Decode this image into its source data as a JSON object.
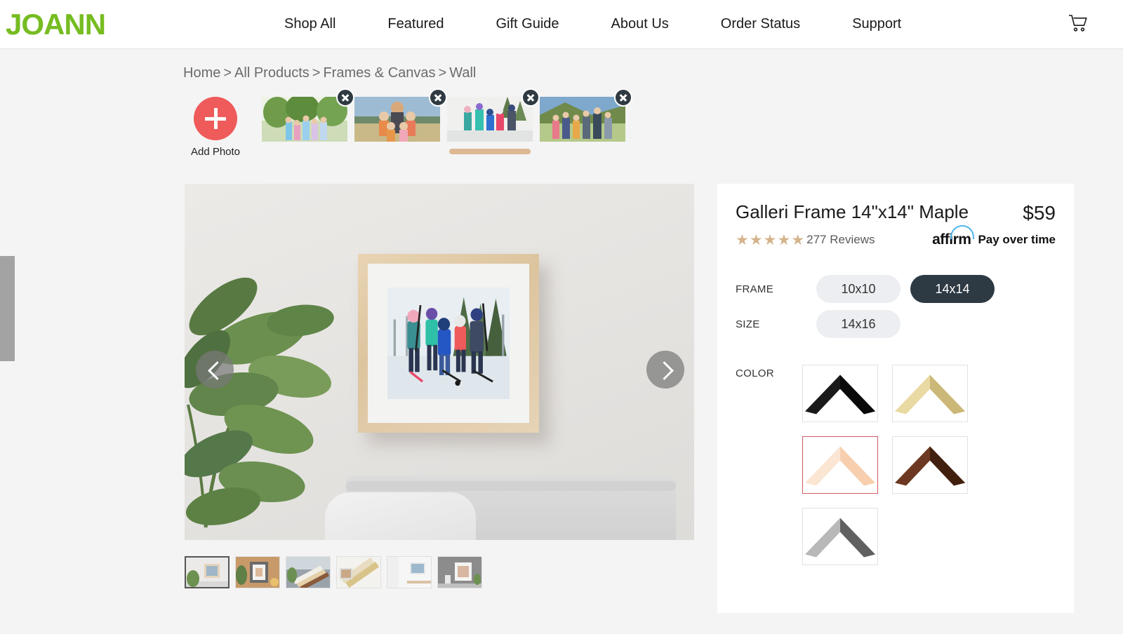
{
  "header": {
    "logo": "JOANN",
    "nav": [
      {
        "label": "Shop All"
      },
      {
        "label": "Featured"
      },
      {
        "label": "Gift Guide"
      },
      {
        "label": "About Us"
      },
      {
        "label": "Order Status"
      },
      {
        "label": "Support"
      }
    ],
    "cart_icon": "shopping-cart-icon"
  },
  "breadcrumb": {
    "items": [
      "Home",
      "All Products",
      "Frames & Canvas",
      "Wall"
    ],
    "separator": ">"
  },
  "photo_strip": {
    "add_photo_label": "Add Photo",
    "add_icon": "plus-icon",
    "delete_icon": "close-circle-icon",
    "photos": [
      {
        "alt": "family-group-trees",
        "selected": false
      },
      {
        "alt": "family-group-beach",
        "selected": false
      },
      {
        "alt": "kids-hockey-winter",
        "selected": true
      },
      {
        "alt": "family-group-vineyard",
        "selected": false
      }
    ]
  },
  "stage": {
    "prev_icon": "chevron-left-icon",
    "next_icon": "chevron-right-icon",
    "scene_alt": "maple-framed-photo-on-living-room-wall"
  },
  "gallery_thumbs": [
    {
      "alt": "framed-photo-livingroom",
      "selected": true
    },
    {
      "alt": "framed-photo-warm-room",
      "selected": false
    },
    {
      "alt": "frame-corners-stack",
      "selected": false
    },
    {
      "alt": "frame-corners-gold",
      "selected": false
    },
    {
      "alt": "frame-on-white-wall",
      "selected": false
    },
    {
      "alt": "frame-on-gray-wall",
      "selected": false
    }
  ],
  "product": {
    "title": "Galleri Frame 14\"x14\" Maple",
    "price": "$59",
    "stars": "★★★★★",
    "star_count": 5,
    "reviews": "277 Reviews",
    "affirm_logo": "affirm",
    "affirm_text": "Pay over time"
  },
  "options": {
    "frame_label": "FRAME",
    "size_label": "SIZE",
    "frame_sizes": [
      {
        "label": "10x10",
        "selected": false
      },
      {
        "label": "14x14",
        "selected": true
      }
    ],
    "sizes": [
      {
        "label": "14x16",
        "selected": false
      }
    ]
  },
  "color": {
    "label": "COLOR",
    "swatches": [
      {
        "name": "black",
        "selected": false,
        "c1": "#3b3b3b",
        "c2": "#0d0d0d"
      },
      {
        "name": "gold",
        "selected": false,
        "c1": "#efe0a8",
        "c2": "#c9b675"
      },
      {
        "name": "maple",
        "selected": true,
        "c1": "#fae3d0",
        "c2": "#f6cfae"
      },
      {
        "name": "walnut",
        "selected": false,
        "c1": "#6b3620",
        "c2": "#3f1c0d"
      },
      {
        "name": "gray",
        "selected": false,
        "c1": "#b9b9b9",
        "c2": "#5c5c5c"
      }
    ]
  },
  "colors": {
    "brand_green": "#76bc21",
    "accent_red": "#ef5a5a",
    "selected_chip": "#2d3943",
    "star": "#d4b48c",
    "affirm_blue": "#4db5ec",
    "selected_swatch_border": "#d05a62",
    "thumb_selected_bar": "#dcb894"
  },
  "scrollbar": {
    "name": "page-scrollbar-thumb"
  }
}
